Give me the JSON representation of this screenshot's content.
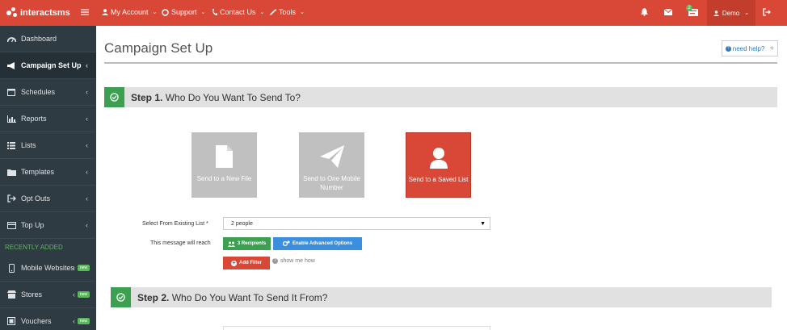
{
  "brand": {
    "name": "interactsms"
  },
  "topnav": {
    "my_account": "My Account",
    "support": "Support",
    "contact_us": "Contact Us",
    "tools": "Tools",
    "notification_count": "2",
    "user": "Demo"
  },
  "sidebar": {
    "items": [
      {
        "label": "Dashboard",
        "icon": "dashboard-icon"
      },
      {
        "label": "Campaign Set Up",
        "icon": "megaphone-icon"
      },
      {
        "label": "Schedules",
        "icon": "calendar-icon"
      },
      {
        "label": "Reports",
        "icon": "bar-chart-icon"
      },
      {
        "label": "Lists",
        "icon": "list-icon"
      },
      {
        "label": "Templates",
        "icon": "folder-icon"
      },
      {
        "label": "Opt Outs",
        "icon": "sign-out-icon"
      },
      {
        "label": "Top Up",
        "icon": "credit-card-icon"
      }
    ],
    "recently_added": "RECENTLY ADDED",
    "recent_items": [
      {
        "label": "Mobile Websites",
        "badge": "new",
        "icon": "mobile-icon"
      },
      {
        "label": "Stores",
        "badge": "new",
        "icon": "store-icon"
      },
      {
        "label": "Vouchers",
        "badge": "new",
        "icon": "voucher-icon"
      }
    ]
  },
  "page": {
    "title": "Campaign Set Up",
    "help": "need help?"
  },
  "step1": {
    "number": "Step 1.",
    "title": "Who Do You Want To Send To?",
    "tiles": [
      {
        "label": "Send to a New File"
      },
      {
        "label": "Send to One Mobile Number"
      },
      {
        "label": "Send to a Saved List"
      }
    ],
    "select_label": "Select From Existing List *",
    "select_value": "2 people",
    "reach_label": "This message will reach",
    "recipients_button": "3 Recipients",
    "advanced_button": "Enable Advanced Options",
    "add_filter_button": "Add Filter",
    "show_me_how": "show me how"
  },
  "step2": {
    "number": "Step 2.",
    "title": "Who Do You Want To Send It From?"
  },
  "colors": {
    "brand_red": "#d94836",
    "sidebar": "#2f3b42",
    "success": "#3da050",
    "info": "#3b8fde"
  }
}
